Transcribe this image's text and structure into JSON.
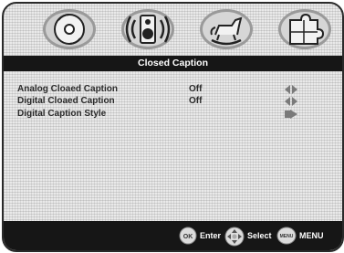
{
  "tabs": [
    {
      "icon": "disc-icon"
    },
    {
      "icon": "speaker-icon"
    },
    {
      "icon": "rocking-horse-icon"
    },
    {
      "icon": "puzzle-icon"
    }
  ],
  "title": "Closed Caption",
  "rows": [
    {
      "label": "Analog Cloaed Caption",
      "value": "Off",
      "arrow": "left-right-arrow-icon"
    },
    {
      "label": "Digital Cloaed Caption",
      "value": "Off",
      "arrow": "left-right-arrow-icon"
    },
    {
      "label": "Digital Caption Style",
      "value": "",
      "arrow": "right-arrow-icon"
    }
  ],
  "footer": {
    "ok_icon_text": "OK",
    "enter_label": "Enter",
    "select_label": "Select",
    "menu_icon_text": "MENU",
    "menu_label": "MENU"
  }
}
